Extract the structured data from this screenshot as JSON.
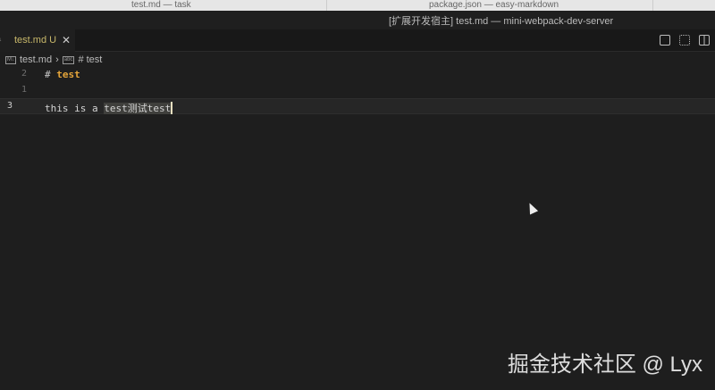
{
  "other_windows": [
    "test.md — task",
    "package.json — easy-markdown"
  ],
  "window_title": "[扩展开发宿主] test.md — mini-webpack-dev-server",
  "tab": {
    "label": "test.md",
    "status": "U",
    "icon": "markdown-icon"
  },
  "breadcrumb": {
    "file": "test.md",
    "symbol": "# test"
  },
  "editor": {
    "lines": [
      {
        "num": "2",
        "hash": "#",
        "heading": "test"
      },
      {
        "num": "1",
        "text": ""
      },
      {
        "num": "3",
        "prefix": "this is a ",
        "selected": "test测试test"
      }
    ]
  },
  "watermark": "掘金技术社区 @ Lyx"
}
